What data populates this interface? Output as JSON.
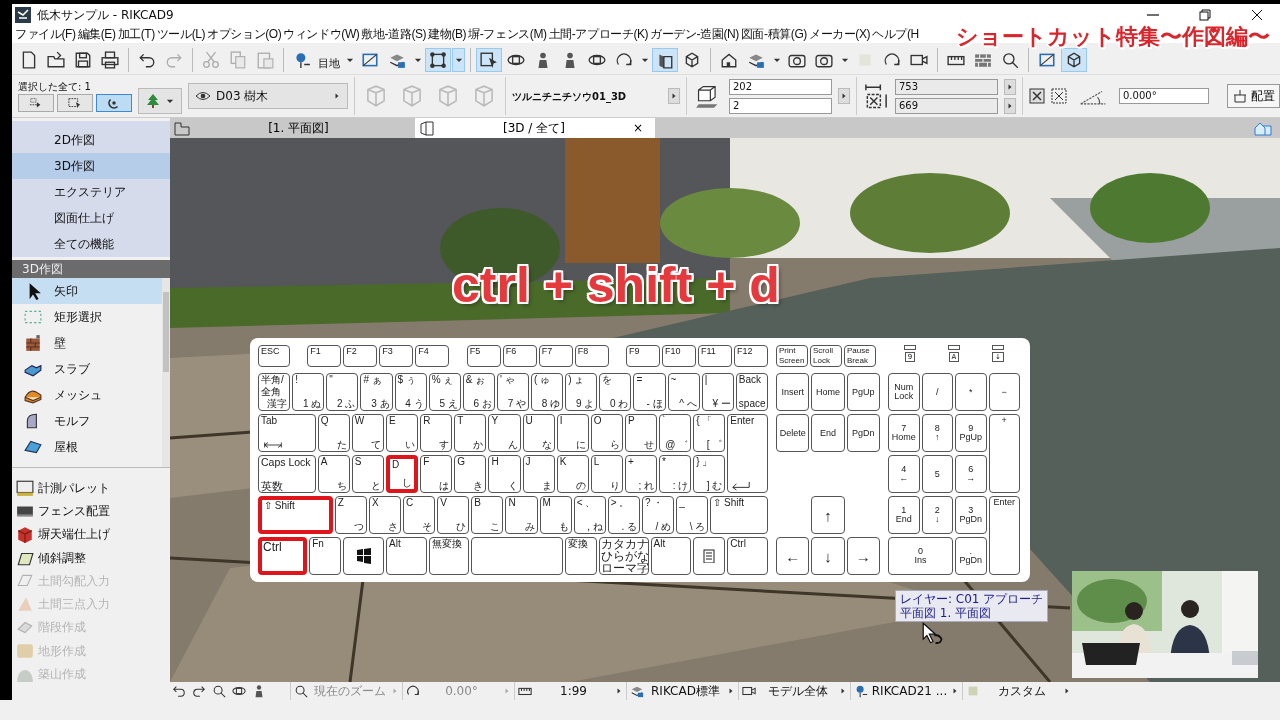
{
  "window": {
    "title": "低木サンプル - RIKCAD9"
  },
  "menu": [
    "ファイル(F)",
    "編集(E)",
    "加工(T)",
    "ツール(L)",
    "オプション(O)",
    "ウィンドウ(W)",
    "敷地-道路(S)",
    "建物(B)",
    "塀-フェンス(M)",
    "土間-アプローチ(K)",
    "ガーデン-造園(N)",
    "図面-積算(G)",
    "メーカー(X)",
    "ヘルプ(H"
  ],
  "overlay_title": "ショートカット特集〜作図編〜",
  "toolbar": [
    {
      "kind": "button",
      "pressed": false,
      "disabled": false
    },
    {
      "kind": "button",
      "pressed": false,
      "disabled": false
    },
    {
      "kind": "button",
      "pressed": false,
      "disabled": false
    },
    {
      "kind": "button",
      "pressed": false,
      "disabled": false
    },
    {
      "kind": "separator"
    },
    {
      "kind": "button",
      "pressed": false,
      "disabled": false
    },
    {
      "kind": "button",
      "pressed": false,
      "disabled": true
    },
    {
      "kind": "separator"
    },
    {
      "kind": "button",
      "pressed": false,
      "disabled": true
    },
    {
      "kind": "button",
      "pressed": false,
      "disabled": true
    },
    {
      "kind": "button",
      "pressed": false,
      "disabled": true
    },
    {
      "kind": "separator"
    },
    {
      "kind": "button",
      "pressed": false,
      "disabled": false
    },
    {
      "kind": "label",
      "text": "目地"
    },
    {
      "kind": "dropdown",
      "pressed": false
    },
    {
      "kind": "button",
      "pressed": false,
      "disabled": false
    },
    {
      "kind": "button",
      "pressed": false,
      "disabled": false
    },
    {
      "kind": "dropdown",
      "pressed": false
    },
    {
      "kind": "button",
      "pressed": true,
      "disabled": false
    },
    {
      "kind": "dropdown",
      "pressed": true
    },
    {
      "kind": "separator"
    },
    {
      "kind": "button",
      "pressed": true,
      "disabled": false
    },
    {
      "kind": "button",
      "pressed": false,
      "disabled": false
    },
    {
      "kind": "button",
      "pressed": false,
      "disabled": false
    },
    {
      "kind": "button",
      "pressed": false,
      "disabled": false
    },
    {
      "kind": "button",
      "pressed": false,
      "disabled": false
    },
    {
      "kind": "button",
      "pressed": false,
      "disabled": false
    },
    {
      "kind": "dropdown",
      "pressed": false
    },
    {
      "kind": "button",
      "pressed": true,
      "disabled": false
    },
    {
      "kind": "button",
      "pressed": false,
      "disabled": false
    },
    {
      "kind": "separator"
    },
    {
      "kind": "button",
      "pressed": false,
      "disabled": false
    },
    {
      "kind": "button",
      "pressed": false,
      "disabled": false
    },
    {
      "kind": "dropdown",
      "pressed": false
    },
    {
      "kind": "button",
      "pressed": false,
      "disabled": false
    },
    {
      "kind": "button",
      "pressed": false,
      "disabled": false
    },
    {
      "kind": "dropdown",
      "pressed": false
    },
    {
      "kind": "button",
      "pressed": false,
      "disabled": true
    },
    {
      "kind": "button",
      "pressed": false,
      "disabled": false
    },
    {
      "kind": "button",
      "pressed": false,
      "disabled": false
    },
    {
      "kind": "separator"
    },
    {
      "kind": "button",
      "pressed": false,
      "disabled": false
    },
    {
      "kind": "button",
      "pressed": false,
      "disabled": false
    },
    {
      "kind": "button",
      "pressed": false,
      "disabled": false
    },
    {
      "kind": "separator"
    },
    {
      "kind": "button",
      "pressed": false,
      "disabled": false
    },
    {
      "kind": "button",
      "pressed": true,
      "disabled": false
    }
  ],
  "info_box": {
    "selection_label": "選択した全て: 1",
    "selection_buttons": [
      {
        "pressed": false
      },
      {
        "pressed": false
      },
      {
        "pressed": true
      }
    ],
    "layer": "D03 樹木",
    "element_name": "ツルニチニチソウ01_3D",
    "height_fields": [
      "202",
      "2"
    ],
    "size_fields": [
      "753",
      "669"
    ],
    "angle": "0.000°",
    "place_button": "配置"
  },
  "view_tabs": [
    {
      "label": "[1. 平面図]",
      "selected": false
    },
    {
      "label": "[3D / 全て]",
      "selected": true,
      "close": "×"
    }
  ],
  "sidebar": {
    "modes": [
      {
        "label": "2D作図",
        "selected": false
      },
      {
        "label": "3D作図",
        "selected": true
      },
      {
        "label": "エクステリア",
        "selected": false
      },
      {
        "label": "図面仕上げ",
        "selected": false
      },
      {
        "label": "全ての機能",
        "selected": false
      }
    ],
    "tool_header": "3D作図",
    "tools": [
      {
        "label": "矢印",
        "selected": true
      },
      {
        "label": "矩形選択",
        "selected": false
      },
      {
        "label": "壁",
        "selected": false
      },
      {
        "label": "スラブ",
        "selected": false
      },
      {
        "label": "メッシュ",
        "selected": false
      },
      {
        "label": "モルフ",
        "selected": false
      },
      {
        "label": "屋根",
        "selected": false
      }
    ],
    "palettes": [
      {
        "label": "計測パレット",
        "disabled": false
      },
      {
        "label": "フェンス配置",
        "disabled": false
      },
      {
        "label": "塀天端仕上げ",
        "disabled": false
      },
      {
        "label": "傾斜調整",
        "disabled": false
      },
      {
        "label": "土間勾配入力",
        "disabled": true
      },
      {
        "label": "土間三点入力",
        "disabled": true
      },
      {
        "label": "階段作成",
        "disabled": true
      },
      {
        "label": "地形作成",
        "disabled": true
      },
      {
        "label": "築山作成",
        "disabled": true
      }
    ]
  },
  "viewport": {
    "headline": "ctrl + shift + d",
    "keyboard": {
      "function_groups": [
        [
          {
            "legends": [
              "ESC"
            ],
            "highlighted": false
          }
        ],
        [
          {
            "legends": [
              "F1"
            ],
            "highlighted": false
          },
          {
            "legends": [
              "F2"
            ],
            "highlighted": false
          },
          {
            "legends": [
              "F3"
            ],
            "highlighted": false
          },
          {
            "legends": [
              "F4"
            ],
            "highlighted": false
          }
        ],
        [
          {
            "legends": [
              "F5"
            ],
            "highlighted": false
          },
          {
            "legends": [
              "F6"
            ],
            "highlighted": false
          },
          {
            "legends": [
              "F7"
            ],
            "highlighted": false
          },
          {
            "legends": [
              "F8"
            ],
            "highlighted": false
          }
        ],
        [
          {
            "legends": [
              "F9"
            ],
            "highlighted": false
          },
          {
            "legends": [
              "F10"
            ],
            "highlighted": false
          },
          {
            "legends": [
              "F11"
            ],
            "highlighted": false
          },
          {
            "legends": [
              "F12"
            ],
            "highlighted": false
          }
        ]
      ],
      "system_keys": [
        {
          "legends": [
            "Print",
            "Screen"
          ],
          "highlighted": false
        },
        {
          "legends": [
            "Scroll",
            "Lock"
          ],
          "highlighted": false
        },
        {
          "legends": [
            "Pause",
            "Break"
          ],
          "highlighted": false
        }
      ],
      "indicators": [
        "9",
        "A",
        "↓"
      ],
      "main_rows": [
        [
          {
            "kind": "key",
            "legends": [
              "半角/",
              "全角",
              "漢字"
            ],
            "highlighted": false
          },
          {
            "kind": "key",
            "legends": [
              "!",
              "1 ぬ"
            ],
            "highlighted": false
          },
          {
            "kind": "key",
            "legends": [
              "\"",
              "2 ふ"
            ],
            "highlighted": false
          },
          {
            "kind": "key",
            "legends": [
              "# ぁ",
              "3 あ"
            ],
            "highlighted": false
          },
          {
            "kind": "key",
            "legends": [
              "$ ぅ",
              "4 う"
            ],
            "highlighted": false
          },
          {
            "kind": "key",
            "legends": [
              "% ぇ",
              "5 え"
            ],
            "highlighted": false
          },
          {
            "kind": "key",
            "legends": [
              "& ぉ",
              "6 お"
            ],
            "highlighted": false
          },
          {
            "kind": "key",
            "legends": [
              "' ゃ",
              "7 や"
            ],
            "highlighted": false
          },
          {
            "kind": "key",
            "legends": [
              "( ゅ",
              "8 ゆ"
            ],
            "highlighted": false
          },
          {
            "kind": "key",
            "legends": [
              ") ょ",
              "9 よ"
            ],
            "highlighted": false
          },
          {
            "kind": "key",
            "legends": [
              "を",
              "0 わ"
            ],
            "highlighted": false
          },
          {
            "kind": "key",
            "legends": [
              "=",
              "- ほ"
            ],
            "highlighted": false
          },
          {
            "kind": "key",
            "legends": [
              "~",
              "^ へ"
            ],
            "highlighted": false
          },
          {
            "kind": "key",
            "legends": [
              "|",
              "¥ ー"
            ],
            "highlighted": false
          },
          {
            "kind": "key",
            "legends": [
              "Back",
              "space"
            ],
            "highlighted": false
          }
        ],
        [
          {
            "kind": "tab",
            "legends": [
              "Tab"
            ],
            "highlighted": false
          },
          {
            "kind": "key",
            "legends": [
              "Q",
              "た"
            ],
            "highlighted": false
          },
          {
            "kind": "key",
            "legends": [
              "W",
              "て"
            ],
            "highlighted": false
          },
          {
            "kind": "key",
            "legends": [
              "E",
              "い"
            ],
            "highlighted": false
          },
          {
            "kind": "key",
            "legends": [
              "R",
              "す"
            ],
            "highlighted": false
          },
          {
            "kind": "key",
            "legends": [
              "T",
              "か"
            ],
            "highlighted": false
          },
          {
            "kind": "key",
            "legends": [
              "Y",
              "ん"
            ],
            "highlighted": false
          },
          {
            "kind": "key",
            "legends": [
              "U",
              "な"
            ],
            "highlighted": false
          },
          {
            "kind": "key",
            "legends": [
              "I",
              "に"
            ],
            "highlighted": false
          },
          {
            "kind": "key",
            "legends": [
              "O",
              "ら"
            ],
            "highlighted": false
          },
          {
            "kind": "key",
            "legends": [
              "P",
              "せ"
            ],
            "highlighted": false
          },
          {
            "kind": "key",
            "legends": [
              "`",
              "@ ゛"
            ],
            "highlighted": false
          },
          {
            "kind": "key",
            "legends": [
              "{ 「",
              "[ ゜"
            ],
            "highlighted": false
          },
          {
            "kind": "enter",
            "legends": [
              "Enter"
            ],
            "highlighted": false
          }
        ],
        [
          {
            "kind": "caps",
            "legends": [
              "Caps Lock",
              "英数"
            ],
            "highlighted": false
          },
          {
            "kind": "key",
            "legends": [
              "A",
              "ち"
            ],
            "highlighted": false
          },
          {
            "kind": "key",
            "legends": [
              "S",
              "と"
            ],
            "highlighted": false
          },
          {
            "kind": "key",
            "legends": [
              "D",
              "し"
            ],
            "highlighted": true
          },
          {
            "kind": "key",
            "legends": [
              "F",
              "は"
            ],
            "highlighted": false
          },
          {
            "kind": "key",
            "legends": [
              "G",
              "き"
            ],
            "highlighted": false
          },
          {
            "kind": "key",
            "legends": [
              "H",
              "く"
            ],
            "highlighted": false
          },
          {
            "kind": "key",
            "legends": [
              "J",
              "ま"
            ],
            "highlighted": false
          },
          {
            "kind": "key",
            "legends": [
              "K",
              "の"
            ],
            "highlighted": false
          },
          {
            "kind": "key",
            "legends": [
              "L",
              "り"
            ],
            "highlighted": false
          },
          {
            "kind": "key",
            "legends": [
              "+",
              "; れ"
            ],
            "highlighted": false
          },
          {
            "kind": "key",
            "legends": [
              "*",
              ": け"
            ],
            "highlighted": false
          },
          {
            "kind": "key",
            "legends": [
              "} 」",
              "] む"
            ],
            "highlighted": false
          }
        ],
        [
          {
            "kind": "shift",
            "legends": [
              "⇧ Shift"
            ],
            "highlighted": true
          },
          {
            "kind": "key",
            "legends": [
              "Z",
              "つ"
            ],
            "highlighted": false
          },
          {
            "kind": "key",
            "legends": [
              "X",
              "さ"
            ],
            "highlighted": false
          },
          {
            "kind": "key",
            "legends": [
              "C",
              "そ"
            ],
            "highlighted": false
          },
          {
            "kind": "key",
            "legends": [
              "V",
              "ひ"
            ],
            "highlighted": false
          },
          {
            "kind": "key",
            "legends": [
              "B",
              "こ"
            ],
            "highlighted": false
          },
          {
            "kind": "key",
            "legends": [
              "N",
              "み"
            ],
            "highlighted": false
          },
          {
            "kind": "key",
            "legends": [
              "M",
              "も"
            ],
            "highlighted": false
          },
          {
            "kind": "key",
            "legends": [
              "< 、",
              ", ね"
            ],
            "highlighted": false
          },
          {
            "kind": "key",
            "legends": [
              "> 。",
              ". る"
            ],
            "highlighted": false
          },
          {
            "kind": "key",
            "legends": [
              "? ・",
              "/ め"
            ],
            "highlighted": false
          },
          {
            "kind": "key",
            "legends": [
              "_",
              "\\ ろ"
            ],
            "highlighted": false
          },
          {
            "kind": "widest",
            "legends": [
              "⇧ Shift"
            ],
            "highlighted": false
          }
        ],
        [
          {
            "kind": "wider",
            "legends": [
              "Ctrl"
            ],
            "highlighted": true
          },
          {
            "kind": "key",
            "legends": [
              "Fn"
            ],
            "highlighted": false
          },
          {
            "kind": "logo",
            "highlighted": false
          },
          {
            "kind": "wide",
            "legends": [
              "Alt"
            ],
            "highlighted": false
          },
          {
            "kind": "wide",
            "legends": [
              "無変換"
            ],
            "highlighted": false
          },
          {
            "kind": "space",
            "highlighted": false
          },
          {
            "kind": "key",
            "legends": [
              "変換"
            ],
            "highlighted": false
          },
          {
            "kind": "wider",
            "legends": [
              "カタカナ",
              "ひらがな",
              "ローマ字"
            ],
            "highlighted": false
          },
          {
            "kind": "wide",
            "legends": [
              "Alt"
            ],
            "highlighted": false
          },
          {
            "kind": "menukey",
            "highlighted": false
          },
          {
            "kind": "wide",
            "legends": [
              "Ctrl"
            ],
            "highlighted": false
          }
        ]
      ],
      "nav_rows": [
        [
          {
            "legends": [
              "Insert"
            ],
            "highlighted": false
          },
          {
            "legends": [
              "Home"
            ],
            "highlighted": false
          },
          {
            "legends": [
              "PgUp"
            ],
            "highlighted": false
          }
        ],
        [
          {
            "legends": [
              "Delete"
            ],
            "highlighted": false
          },
          {
            "legends": [
              "End"
            ],
            "highlighted": false
          },
          {
            "legends": [
              "PgDn"
            ],
            "highlighted": false
          }
        ],
        [
          {
            "legends": [
              "↑"
            ],
            "highlighted": false
          }
        ],
        [
          {
            "legends": [
              "←"
            ],
            "highlighted": false
          },
          {
            "legends": [
              "↓"
            ],
            "highlighted": false
          },
          {
            "legends": [
              "→"
            ],
            "highlighted": false
          }
        ]
      ],
      "numpad": [
        {
          "kind": "key",
          "legends": [
            "Num",
            "Lock"
          ],
          "highlighted": false
        },
        {
          "kind": "key",
          "legends": [
            "/"
          ],
          "highlighted": false
        },
        {
          "kind": "key",
          "legends": [
            "*"
          ],
          "highlighted": false
        },
        {
          "kind": "key",
          "legends": [
            "−"
          ],
          "highlighted": false
        },
        {
          "kind": "key",
          "legends": [
            "7",
            "Home"
          ],
          "highlighted": false
        },
        {
          "kind": "key",
          "legends": [
            "8",
            "↑"
          ],
          "highlighted": false
        },
        {
          "kind": "key",
          "legends": [
            "9",
            "PgUp"
          ],
          "highlighted": false
        },
        {
          "kind": "tall",
          "legends": [
            "+"
          ],
          "highlighted": false
        },
        {
          "kind": "key",
          "legends": [
            "4",
            "←"
          ],
          "highlighted": false
        },
        {
          "kind": "key",
          "legends": [
            "5"
          ],
          "highlighted": false
        },
        {
          "kind": "key",
          "legends": [
            "6",
            "→"
          ],
          "highlighted": false
        },
        {
          "kind": "key",
          "legends": [
            "1",
            "End"
          ],
          "highlighted": false
        },
        {
          "kind": "key",
          "legends": [
            "2",
            "↓"
          ],
          "highlighted": false
        },
        {
          "kind": "key",
          "legends": [
            "3",
            "PgDn"
          ],
          "highlighted": false
        },
        {
          "kind": "tall",
          "legends": [
            "Enter"
          ],
          "highlighted": false
        },
        {
          "kind": "wide",
          "legends": [
            "0",
            "Ins"
          ],
          "highlighted": false
        },
        {
          "kind": "key",
          "legends": [
            ".",
            "PgDn"
          ],
          "highlighted": false
        }
      ]
    },
    "tooltip": [
      "レイヤー: C01 アプローチ",
      "平面図 1. 平面図"
    ]
  },
  "status_bar": [
    {
      "text": "現在のズーム",
      "disabled": true
    },
    {
      "text": "0.00°",
      "disabled": true
    },
    {
      "text": "1:99",
      "disabled": false
    },
    {
      "text": "RIKCAD標準",
      "disabled": false
    },
    {
      "text": "モデル全体",
      "disabled": false
    },
    {
      "text": "RIKCAD21 ...",
      "disabled": false
    },
    {
      "text": "カスタム",
      "disabled": false
    }
  ]
}
